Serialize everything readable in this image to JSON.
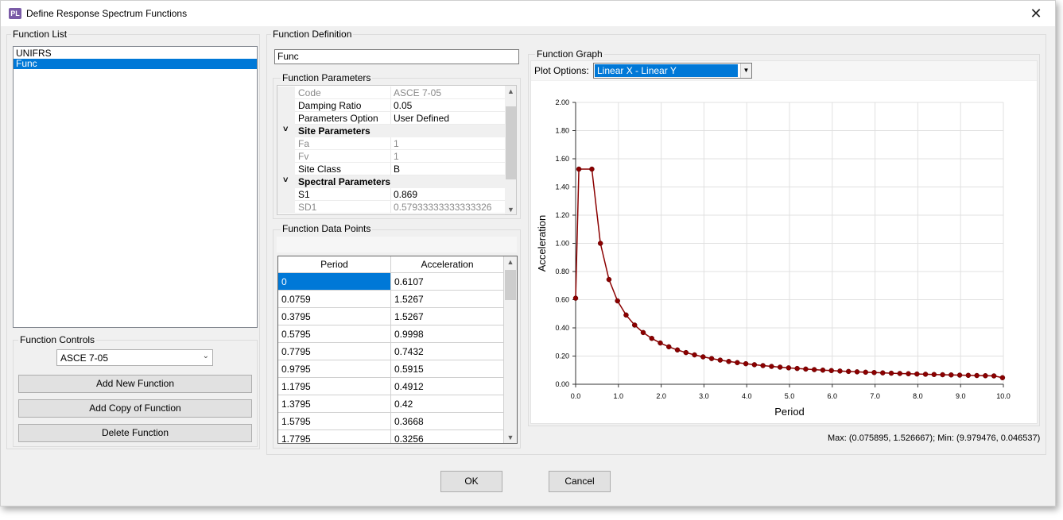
{
  "window": {
    "app_icon_text": "PL",
    "title": "Define Response Spectrum Functions",
    "close_glyph": "✕"
  },
  "function_list": {
    "legend": "Function List",
    "items": [
      {
        "label": "UNIFRS",
        "selected": false
      },
      {
        "label": "Func",
        "selected": true
      }
    ]
  },
  "function_controls": {
    "legend": "Function Controls",
    "code_value": "ASCE 7-05",
    "add_new_label": "Add New Function",
    "add_copy_label": "Add Copy of Function",
    "delete_label": "Delete Function"
  },
  "function_definition": {
    "legend": "Function Definition",
    "name_value": "Func",
    "parameters_legend": "Function Parameters",
    "parameters": [
      {
        "kind": "prop",
        "name": "Code",
        "value": "ASCE 7-05",
        "disabled": true
      },
      {
        "kind": "prop",
        "name": "Damping Ratio",
        "value": "0.05",
        "disabled": false
      },
      {
        "kind": "prop",
        "name": "Parameters Option",
        "value": "User Defined",
        "disabled": false
      },
      {
        "kind": "category",
        "name": "Site Parameters",
        "value": ""
      },
      {
        "kind": "prop",
        "name": "Fa",
        "value": "1",
        "disabled": true
      },
      {
        "kind": "prop",
        "name": "Fv",
        "value": "1",
        "disabled": true
      },
      {
        "kind": "prop",
        "name": "Site Class",
        "value": "B",
        "disabled": false
      },
      {
        "kind": "category",
        "name": "Spectral Parameters",
        "value": ""
      },
      {
        "kind": "prop",
        "name": "S1",
        "value": "0.869",
        "disabled": false
      },
      {
        "kind": "prop",
        "name": "SD1",
        "value": "0.57933333333333326",
        "disabled": true
      }
    ],
    "data_points_legend": "Function Data Points",
    "columns": [
      "Period",
      "Acceleration"
    ],
    "rows": [
      [
        "0",
        "0.6107"
      ],
      [
        "0.0759",
        "1.5267"
      ],
      [
        "0.3795",
        "1.5267"
      ],
      [
        "0.5795",
        "0.9998"
      ],
      [
        "0.7795",
        "0.7432"
      ],
      [
        "0.9795",
        "0.5915"
      ],
      [
        "1.1795",
        "0.4912"
      ],
      [
        "1.3795",
        "0.42"
      ],
      [
        "1.5795",
        "0.3668"
      ],
      [
        "1.7795",
        "0.3256"
      ]
    ]
  },
  "function_graph": {
    "legend": "Function Graph",
    "plot_options_label": "Plot Options:",
    "plot_options_value": "Linear X - Linear Y",
    "max_min_text": "Max: (0.075895, 1.526667);   Min: (9.979476, 0.046537)"
  },
  "chart_data": {
    "type": "line",
    "xlabel": "Period",
    "ylabel": "Acceleration",
    "xlim": [
      0,
      10
    ],
    "ylim": [
      0,
      2
    ],
    "x_ticks": [
      "0.0",
      "1.0",
      "2.0",
      "3.0",
      "4.0",
      "5.0",
      "6.0",
      "7.0",
      "8.0",
      "9.0",
      "10.0"
    ],
    "y_ticks": [
      "0.00",
      "0.20",
      "0.40",
      "0.60",
      "0.80",
      "1.00",
      "1.20",
      "1.40",
      "1.60",
      "1.80",
      "2.00"
    ],
    "grid": true,
    "color": "#8b0000",
    "series": [
      {
        "x": [
          0,
          0.0759,
          0.3795,
          0.5795,
          0.7795,
          0.9795,
          1.1795,
          1.3795,
          1.5795,
          1.7795,
          1.9795,
          2.1795,
          2.3795,
          2.5795,
          2.7795,
          2.9795,
          3.1795,
          3.3795,
          3.5795,
          3.7795,
          3.9795,
          4.1795,
          4.3795,
          4.5795,
          4.7795,
          4.9795,
          5.1795,
          5.3795,
          5.5795,
          5.7795,
          5.9795,
          6.1795,
          6.3795,
          6.5795,
          6.7795,
          6.9795,
          7.1795,
          7.3795,
          7.5795,
          7.7795,
          7.9795,
          8.1795,
          8.3795,
          8.5795,
          8.7795,
          8.9795,
          9.1795,
          9.3795,
          9.5795,
          9.7795,
          9.9795
        ],
        "y": [
          0.6107,
          1.5267,
          1.5267,
          0.9998,
          0.7432,
          0.5915,
          0.4912,
          0.42,
          0.3668,
          0.3256,
          0.2927,
          0.2658,
          0.2435,
          0.2246,
          0.2084,
          0.1944,
          0.1822,
          0.1714,
          0.1618,
          0.1533,
          0.1456,
          0.1386,
          0.1323,
          0.1265,
          0.1212,
          0.1163,
          0.1118,
          0.1077,
          0.1038,
          0.1002,
          0.0969,
          0.0937,
          0.0908,
          0.088,
          0.0854,
          0.083,
          0.0807,
          0.0785,
          0.0764,
          0.0745,
          0.0726,
          0.0708,
          0.0691,
          0.0675,
          0.066,
          0.0645,
          0.0631,
          0.0618,
          0.0605,
          0.0592,
          0.0465
        ]
      }
    ]
  },
  "footer": {
    "ok_label": "OK",
    "cancel_label": "Cancel"
  }
}
